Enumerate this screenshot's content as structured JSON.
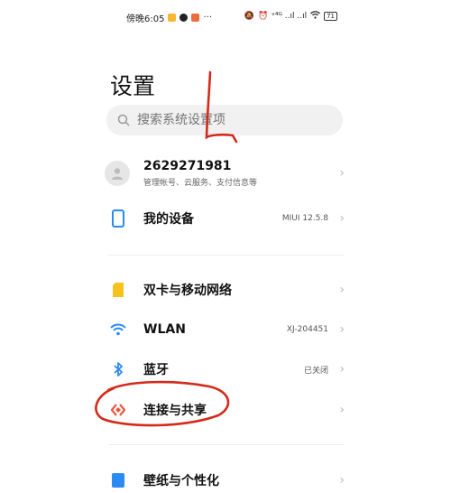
{
  "status_bar": {
    "time": "傍晚6:05",
    "right": "ᵛ⁴ᴳ ..ıl ..ıl",
    "battery": "71"
  },
  "page": {
    "title": "设置"
  },
  "search": {
    "placeholder": "搜索系统设置项"
  },
  "account": {
    "name": "2629271981",
    "subtitle": "管理帐号、云服务、支付信息等"
  },
  "device": {
    "label": "我的设备",
    "value": "MIUI 12.5.8"
  },
  "items": [
    {
      "label": "双卡与移动网络",
      "value": "",
      "icon": "sim-card-icon",
      "color": "#f6c21d"
    },
    {
      "label": "WLAN",
      "value": "XJ-204451",
      "icon": "wifi-icon",
      "color": "#2b8bf2"
    },
    {
      "label": "蓝牙",
      "value": "已关闭",
      "icon": "bluetooth-icon",
      "color": "#2b8bf2"
    },
    {
      "label": "连接与共享",
      "value": "",
      "icon": "connection-share-icon",
      "color": "#e8563f"
    },
    {
      "label": "壁纸与个性化",
      "value": "",
      "icon": "wallpaper-icon",
      "color": "#2b8bf2"
    }
  ],
  "colors": {
    "annotation": "#d42a1a",
    "accent": "#2b8bf2"
  }
}
